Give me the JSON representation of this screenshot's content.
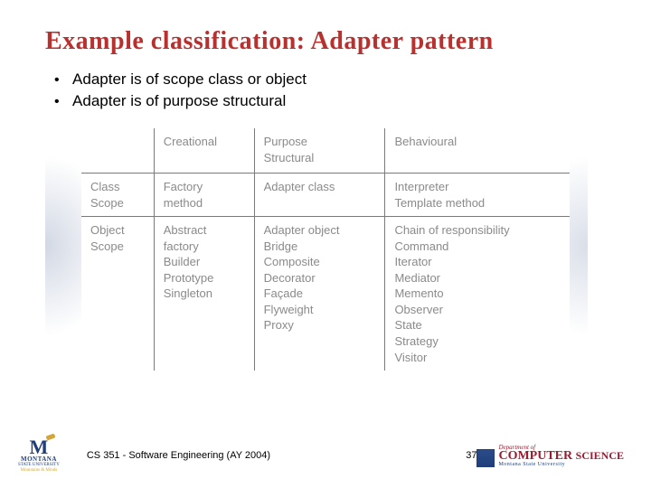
{
  "title": "Example classification: Adapter pattern",
  "bullets": {
    "b1": "Adapter is of scope class or object",
    "b2": "Adapter is of purpose structural"
  },
  "table": {
    "headers": {
      "empty": "",
      "creational": "Creational",
      "structural": "Purpose\nStructural",
      "behavioural": "Behavioural"
    },
    "row1": {
      "scope": "Class\nScope",
      "creational": "Factory\nmethod",
      "structural": "Adapter class",
      "behavioural": "Interpreter\nTemplate method"
    },
    "row2": {
      "scope": "Object\nScope",
      "creational": "Abstract\nfactory\nBuilder\nPrototype\nSingleton",
      "structural": "Adapter object\nBridge\nComposite\nDecorator\nFaçade\nFlyweight\nProxy",
      "behavioural": "Chain of responsibility\nCommand\nIterator\nMediator\nMemento\nObserver\nState\nStrategy\nVisitor"
    }
  },
  "footer": {
    "course": "CS 351 - Software Engineering (AY 2004)",
    "page": "37"
  },
  "logos": {
    "msu_m": "M",
    "msu_name": "MONTANA",
    "msu_sub": "STATE UNIVERSITY",
    "msu_mof": "Mountains & Minds",
    "cs_dept": "Department of",
    "cs_main1": "COMPUTER",
    "cs_main2": "SCIENCE",
    "cs_sub": "Montana State University"
  }
}
